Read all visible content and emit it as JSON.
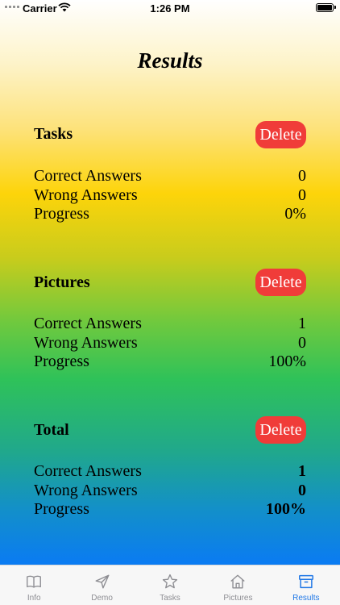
{
  "status_bar": {
    "carrier": "Carrier",
    "time": "1:26 PM"
  },
  "page_title": "Results",
  "sections": [
    {
      "title": "Tasks",
      "delete_label": "Delete",
      "rows": [
        {
          "label": "Correct Answers",
          "value": "0"
        },
        {
          "label": "Wrong Answers",
          "value": "0"
        },
        {
          "label": "Progress",
          "value": "0%"
        }
      ]
    },
    {
      "title": "Pictures",
      "delete_label": "Delete",
      "rows": [
        {
          "label": "Correct Answers",
          "value": "1"
        },
        {
          "label": "Wrong Answers",
          "value": "0"
        },
        {
          "label": "Progress",
          "value": "100%"
        }
      ]
    },
    {
      "title": "Total",
      "delete_label": "Delete",
      "rows": [
        {
          "label": "Correct Answers",
          "value": "1"
        },
        {
          "label": "Wrong Answers",
          "value": "0"
        },
        {
          "label": "Progress",
          "value": "100%"
        }
      ]
    }
  ],
  "tab_bar": {
    "items": [
      {
        "label": "Info",
        "icon": "book-icon"
      },
      {
        "label": "Demo",
        "icon": "paper-plane-icon"
      },
      {
        "label": "Tasks",
        "icon": "star-icon"
      },
      {
        "label": "Pictures",
        "icon": "house-icon"
      },
      {
        "label": "Results",
        "icon": "archive-box-icon"
      }
    ],
    "active": "Results",
    "active_color": "#1f77e6",
    "inactive_color": "#8e8e93"
  },
  "colors": {
    "delete_button": "#f03c39",
    "gradient": [
      "#ffffff",
      "#fdd40a",
      "#2fc259",
      "#0a7bf3"
    ]
  }
}
